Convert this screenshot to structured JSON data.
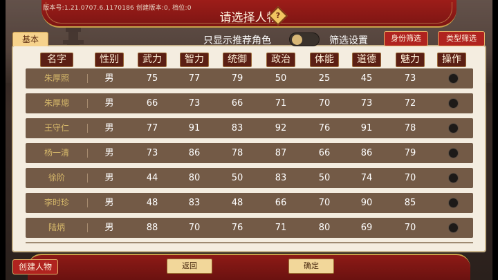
{
  "header": {
    "version": "版本号:1.21.0707.6.1170186   创建版本:0, 档位:0",
    "title": "请选择人物",
    "help_icon": "help-question-icon"
  },
  "filters": {
    "tab_basic": "基本",
    "only_recommended": "只显示推荐角色",
    "toggle_on": false,
    "filter_settings": "筛选设置",
    "identity_filter": "身份筛选",
    "type_filter": "类型筛选"
  },
  "columns": [
    "名字",
    "性别",
    "武力",
    "智力",
    "统御",
    "政治",
    "体能",
    "道德",
    "魅力",
    "操作"
  ],
  "rows": [
    {
      "name": "朱厚照",
      "gender": "男",
      "force": "75",
      "intellect": "77",
      "command": "79",
      "politics": "50",
      "stamina": "25",
      "morality": "45",
      "charm": "73"
    },
    {
      "name": "朱厚熜",
      "gender": "男",
      "force": "66",
      "intellect": "73",
      "command": "66",
      "politics": "71",
      "stamina": "70",
      "morality": "73",
      "charm": "72"
    },
    {
      "name": "王守仁",
      "gender": "男",
      "force": "77",
      "intellect": "91",
      "command": "83",
      "politics": "92",
      "stamina": "76",
      "morality": "91",
      "charm": "78"
    },
    {
      "name": "杨一清",
      "gender": "男",
      "force": "73",
      "intellect": "86",
      "command": "78",
      "politics": "87",
      "stamina": "66",
      "morality": "86",
      "charm": "79"
    },
    {
      "name": "徐阶",
      "gender": "男",
      "force": "44",
      "intellect": "80",
      "command": "50",
      "politics": "83",
      "stamina": "50",
      "morality": "74",
      "charm": "70"
    },
    {
      "name": "李时珍",
      "gender": "男",
      "force": "48",
      "intellect": "83",
      "command": "48",
      "politics": "66",
      "stamina": "70",
      "morality": "90",
      "charm": "85"
    },
    {
      "name": "陆炳",
      "gender": "男",
      "force": "88",
      "intellect": "70",
      "command": "76",
      "politics": "71",
      "stamina": "80",
      "morality": "69",
      "charm": "70"
    }
  ],
  "bottom": {
    "create": "创建人物",
    "back": "返回",
    "confirm": "确定"
  },
  "colors": {
    "header_red": "#9d1d19",
    "row_brown": "#735a46",
    "column_header": "#5b1f14",
    "name_gold": "#d6b86a"
  }
}
